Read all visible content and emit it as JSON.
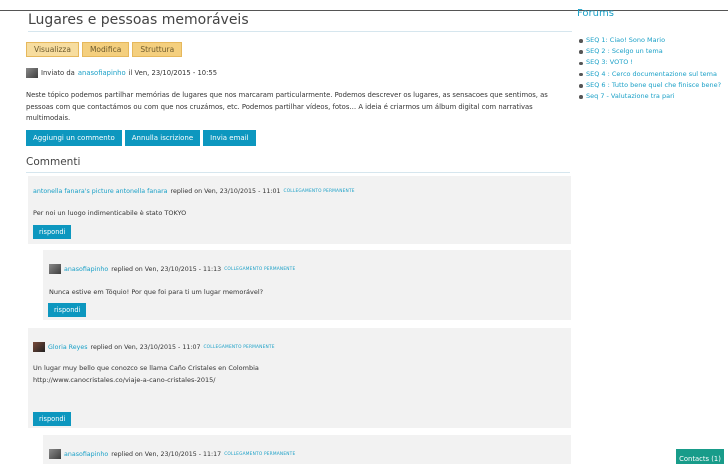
{
  "node": {
    "title": "Lugares e pessoas memoráveis",
    "tabs": [
      "Visualizza",
      "Modifica",
      "Struttura"
    ],
    "submitted_prefix": "Inviato da",
    "author": "anasofiapinho",
    "submitted_date": "il Ven, 23/10/2015 - 10:55",
    "body": "Neste tópico podemos partilhar memórias de lugares que nos marcaram particularmente. Podemos descrever os lugares, as sensacoes que sentimos, as pessoas com que contactámos ou com que nos cruzámos, etc. Podemos partilhar vídeos, fotos… A ideia é criarmos um álbum digital com narrativas multimodais.",
    "actions": [
      "Aggiungi un commento",
      "Annulla iscrizione",
      "Invia email"
    ]
  },
  "comments_title": "Commenti",
  "permalink_label": "COLLEGAMENTO PERMANENTE",
  "reply_label": "rispondi",
  "comments": [
    {
      "author_link": "antonella fanara's picture antonella fanara",
      "meta": "replied on Ven, 23/10/2015 - 11:01",
      "text": "Per noi un luogo indimenticabile è stato TOKYO"
    },
    {
      "author_link": "anasofiapinho",
      "meta": "replied on Ven, 23/10/2015 - 11:13",
      "text": "Nunca estive em Tóquio! Por que foi para ti um lugar memorável?"
    },
    {
      "author_link": "Gloria Reyes",
      "meta": "replied on Ven, 23/10/2015 - 11:07",
      "text": "Un lugar muy bello que conozco se llama Caño Cristales en Colombia",
      "url": "http://www.canocristales.co/viaje-a-cano-cristales-2015/"
    },
    {
      "author_link": "anasofiapinho",
      "meta": "replied on Ven, 23/10/2015 - 11:17"
    }
  ],
  "sidebar": {
    "title": "Forums",
    "items": [
      "SEQ 1: Ciao! Sono Mario",
      "SEQ 2 : Scelgo un tema",
      "SEQ 3: VOTO !",
      "SEQ 4 : Cerco documentazione sul tema",
      "SEQ 6 : Tutto bene quel che finisce bene?",
      "Seq 7 - Valutazione tra pari"
    ]
  },
  "contacts_label": "Contacts (1)"
}
